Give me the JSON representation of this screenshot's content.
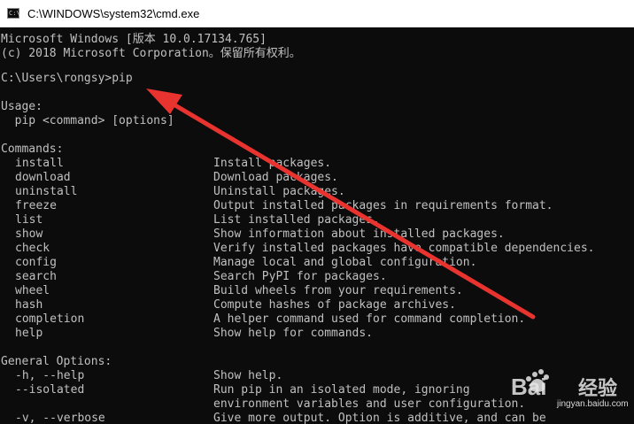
{
  "window": {
    "title": "C:\\WINDOWS\\system32\\cmd.exe",
    "icon_label": "C:\\"
  },
  "console": {
    "header_lines": [
      "Microsoft Windows [版本 10.0.17134.765]",
      "(c) 2018 Microsoft Corporation。保留所有权利。"
    ],
    "prompt": "C:\\Users\\rongsy>pip",
    "usage_heading": "Usage:",
    "usage_line": "  pip <command> [options]",
    "commands_heading": "Commands:",
    "commands": [
      {
        "name": "install",
        "desc": "Install packages."
      },
      {
        "name": "download",
        "desc": "Download packages."
      },
      {
        "name": "uninstall",
        "desc": "Uninstall packages."
      },
      {
        "name": "freeze",
        "desc": "Output installed packages in requirements format."
      },
      {
        "name": "list",
        "desc": "List installed packages."
      },
      {
        "name": "show",
        "desc": "Show information about installed packages."
      },
      {
        "name": "check",
        "desc": "Verify installed packages have compatible dependencies."
      },
      {
        "name": "config",
        "desc": "Manage local and global configuration."
      },
      {
        "name": "search",
        "desc": "Search PyPI for packages."
      },
      {
        "name": "wheel",
        "desc": "Build wheels from your requirements."
      },
      {
        "name": "hash",
        "desc": "Compute hashes of package archives."
      },
      {
        "name": "completion",
        "desc": "A helper command used for command completion."
      },
      {
        "name": "help",
        "desc": "Show help for commands."
      }
    ],
    "general_heading": "General Options:",
    "options": [
      {
        "name": "-h, --help",
        "desc": "Show help."
      },
      {
        "name": "--isolated",
        "desc": "Run pip in an isolated mode, ignoring"
      },
      {
        "name": "",
        "desc": "environment variables and user configuration."
      },
      {
        "name": "-v, --verbose",
        "desc": "Give more output. Option is additive, and can be"
      }
    ]
  },
  "watermark": {
    "brand": "Baidu经验",
    "url": "jingyan.baidu.com"
  },
  "colors": {
    "console_bg": "#0c0c0c",
    "console_text": "#c0c0c0",
    "arrow": "#e8332e"
  }
}
